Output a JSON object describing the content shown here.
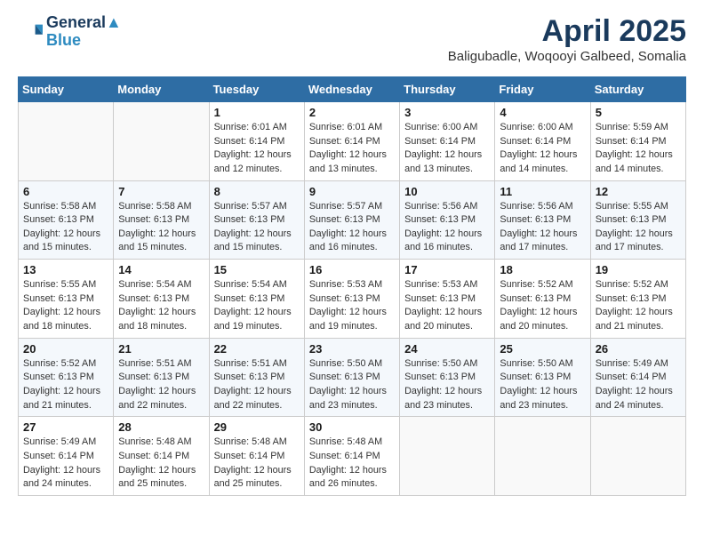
{
  "header": {
    "logo_line1": "General",
    "logo_line2": "Blue",
    "month": "April 2025",
    "location": "Baligubadle, Woqooyi Galbeed, Somalia"
  },
  "weekdays": [
    "Sunday",
    "Monday",
    "Tuesday",
    "Wednesday",
    "Thursday",
    "Friday",
    "Saturday"
  ],
  "weeks": [
    [
      {
        "day": "",
        "info": ""
      },
      {
        "day": "",
        "info": ""
      },
      {
        "day": "1",
        "info": "Sunrise: 6:01 AM\nSunset: 6:14 PM\nDaylight: 12 hours and 12 minutes."
      },
      {
        "day": "2",
        "info": "Sunrise: 6:01 AM\nSunset: 6:14 PM\nDaylight: 12 hours and 13 minutes."
      },
      {
        "day": "3",
        "info": "Sunrise: 6:00 AM\nSunset: 6:14 PM\nDaylight: 12 hours and 13 minutes."
      },
      {
        "day": "4",
        "info": "Sunrise: 6:00 AM\nSunset: 6:14 PM\nDaylight: 12 hours and 14 minutes."
      },
      {
        "day": "5",
        "info": "Sunrise: 5:59 AM\nSunset: 6:14 PM\nDaylight: 12 hours and 14 minutes."
      }
    ],
    [
      {
        "day": "6",
        "info": "Sunrise: 5:58 AM\nSunset: 6:13 PM\nDaylight: 12 hours and 15 minutes."
      },
      {
        "day": "7",
        "info": "Sunrise: 5:58 AM\nSunset: 6:13 PM\nDaylight: 12 hours and 15 minutes."
      },
      {
        "day": "8",
        "info": "Sunrise: 5:57 AM\nSunset: 6:13 PM\nDaylight: 12 hours and 15 minutes."
      },
      {
        "day": "9",
        "info": "Sunrise: 5:57 AM\nSunset: 6:13 PM\nDaylight: 12 hours and 16 minutes."
      },
      {
        "day": "10",
        "info": "Sunrise: 5:56 AM\nSunset: 6:13 PM\nDaylight: 12 hours and 16 minutes."
      },
      {
        "day": "11",
        "info": "Sunrise: 5:56 AM\nSunset: 6:13 PM\nDaylight: 12 hours and 17 minutes."
      },
      {
        "day": "12",
        "info": "Sunrise: 5:55 AM\nSunset: 6:13 PM\nDaylight: 12 hours and 17 minutes."
      }
    ],
    [
      {
        "day": "13",
        "info": "Sunrise: 5:55 AM\nSunset: 6:13 PM\nDaylight: 12 hours and 18 minutes."
      },
      {
        "day": "14",
        "info": "Sunrise: 5:54 AM\nSunset: 6:13 PM\nDaylight: 12 hours and 18 minutes."
      },
      {
        "day": "15",
        "info": "Sunrise: 5:54 AM\nSunset: 6:13 PM\nDaylight: 12 hours and 19 minutes."
      },
      {
        "day": "16",
        "info": "Sunrise: 5:53 AM\nSunset: 6:13 PM\nDaylight: 12 hours and 19 minutes."
      },
      {
        "day": "17",
        "info": "Sunrise: 5:53 AM\nSunset: 6:13 PM\nDaylight: 12 hours and 20 minutes."
      },
      {
        "day": "18",
        "info": "Sunrise: 5:52 AM\nSunset: 6:13 PM\nDaylight: 12 hours and 20 minutes."
      },
      {
        "day": "19",
        "info": "Sunrise: 5:52 AM\nSunset: 6:13 PM\nDaylight: 12 hours and 21 minutes."
      }
    ],
    [
      {
        "day": "20",
        "info": "Sunrise: 5:52 AM\nSunset: 6:13 PM\nDaylight: 12 hours and 21 minutes."
      },
      {
        "day": "21",
        "info": "Sunrise: 5:51 AM\nSunset: 6:13 PM\nDaylight: 12 hours and 22 minutes."
      },
      {
        "day": "22",
        "info": "Sunrise: 5:51 AM\nSunset: 6:13 PM\nDaylight: 12 hours and 22 minutes."
      },
      {
        "day": "23",
        "info": "Sunrise: 5:50 AM\nSunset: 6:13 PM\nDaylight: 12 hours and 23 minutes."
      },
      {
        "day": "24",
        "info": "Sunrise: 5:50 AM\nSunset: 6:13 PM\nDaylight: 12 hours and 23 minutes."
      },
      {
        "day": "25",
        "info": "Sunrise: 5:50 AM\nSunset: 6:13 PM\nDaylight: 12 hours and 23 minutes."
      },
      {
        "day": "26",
        "info": "Sunrise: 5:49 AM\nSunset: 6:14 PM\nDaylight: 12 hours and 24 minutes."
      }
    ],
    [
      {
        "day": "27",
        "info": "Sunrise: 5:49 AM\nSunset: 6:14 PM\nDaylight: 12 hours and 24 minutes."
      },
      {
        "day": "28",
        "info": "Sunrise: 5:48 AM\nSunset: 6:14 PM\nDaylight: 12 hours and 25 minutes."
      },
      {
        "day": "29",
        "info": "Sunrise: 5:48 AM\nSunset: 6:14 PM\nDaylight: 12 hours and 25 minutes."
      },
      {
        "day": "30",
        "info": "Sunrise: 5:48 AM\nSunset: 6:14 PM\nDaylight: 12 hours and 26 minutes."
      },
      {
        "day": "",
        "info": ""
      },
      {
        "day": "",
        "info": ""
      },
      {
        "day": "",
        "info": ""
      }
    ]
  ]
}
